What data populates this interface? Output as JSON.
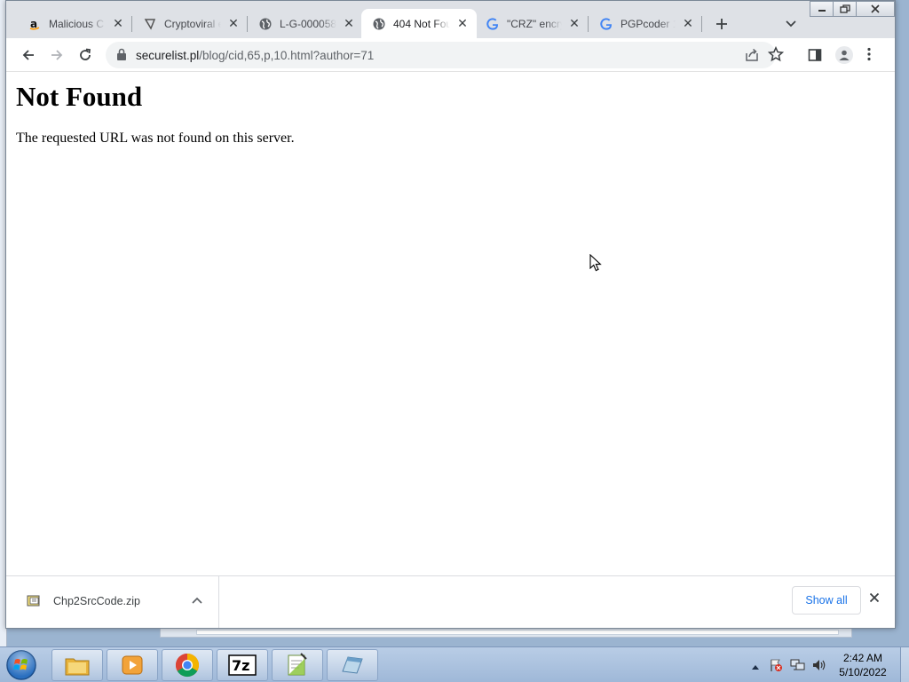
{
  "browser": {
    "tabs": [
      {
        "title": "Malicious C",
        "icon": "amazon-icon",
        "active": false
      },
      {
        "title": "Cryptoviral e",
        "icon": "crypto-site-icon",
        "active": false
      },
      {
        "title": "L-G-000058",
        "icon": "globe-icon",
        "active": false
      },
      {
        "title": "404 Not Fou",
        "icon": "globe-icon",
        "active": true
      },
      {
        "title": "\"CRZ\" encry",
        "icon": "google-icon",
        "active": false
      },
      {
        "title": "PGPcoder 1",
        "icon": "google-icon",
        "active": false
      }
    ],
    "url_domain": "securelist.pl",
    "url_path": "/blog/cid,65,p,10.html?author=71"
  },
  "page": {
    "heading": "Not Found",
    "message": "The requested URL was not found on this server."
  },
  "downloads": {
    "file_name": "Chp2SrcCode.zip",
    "show_all_label": "Show all"
  },
  "taskbar": {
    "apps": [
      "windows-explorer-icon",
      "media-player-icon",
      "chrome-icon",
      "7zip-icon",
      "notepad-plus-icon",
      "generic-app-icon"
    ],
    "time": "2:42 AM",
    "date": "5/10/2022"
  },
  "colors": {
    "link_blue": "#1a73e8",
    "tabstrip_bg": "#dee1e6",
    "taskbar_blue": "#a9c1df"
  }
}
